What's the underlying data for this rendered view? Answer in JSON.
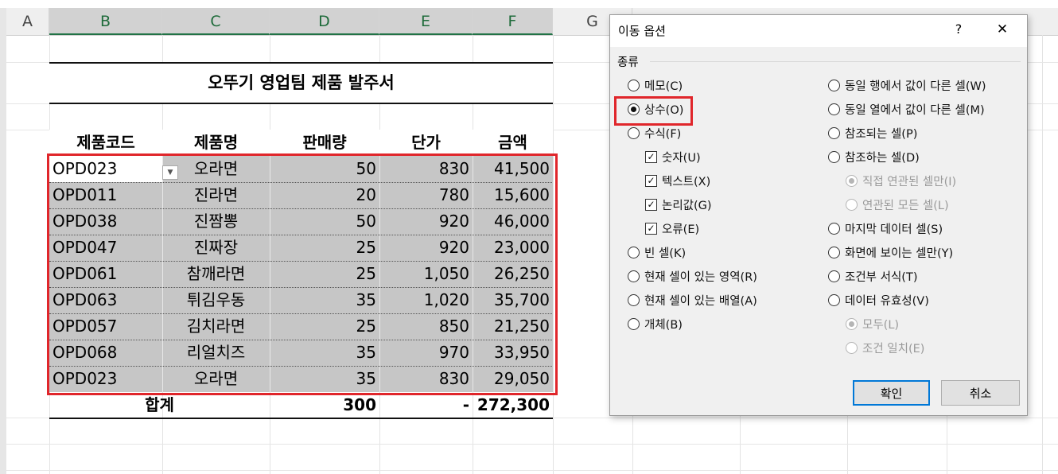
{
  "columns": [
    "A",
    "B",
    "C",
    "D",
    "E",
    "F",
    "G"
  ],
  "sheet": {
    "title": "오뚜기 영업팀 제품 발주서",
    "headers": [
      "제품코드",
      "제품명",
      "판매량",
      "단가",
      "금액"
    ],
    "rows": [
      [
        "OPD023",
        "오라면",
        "50",
        "830",
        "41,500"
      ],
      [
        "OPD011",
        "진라면",
        "20",
        "780",
        "15,600"
      ],
      [
        "OPD038",
        "진짬뽕",
        "50",
        "920",
        "46,000"
      ],
      [
        "OPD047",
        "진짜장",
        "25",
        "920",
        "23,000"
      ],
      [
        "OPD061",
        "참깨라면",
        "25",
        "1,050",
        "26,250"
      ],
      [
        "OPD063",
        "튀김우동",
        "35",
        "1,020",
        "35,700"
      ],
      [
        "OPD057",
        "김치라면",
        "25",
        "850",
        "21,250"
      ],
      [
        "OPD068",
        "리얼치즈",
        "35",
        "970",
        "33,950"
      ],
      [
        "OPD023",
        "오라면",
        "35",
        "830",
        "29,050"
      ]
    ],
    "total": {
      "label": "합계",
      "qty": "300",
      "price": "-",
      "amount": "272,300"
    }
  },
  "dialog": {
    "title": "이동 옵션",
    "help": "?",
    "close": "✕",
    "group_label": "종류",
    "left_options": [
      {
        "label": "메모(C)",
        "type": "radio",
        "checked": false,
        "enabled": true,
        "indent": 0
      },
      {
        "label": "상수(O)",
        "type": "radio",
        "checked": true,
        "enabled": true,
        "indent": 0
      },
      {
        "label": "수식(F)",
        "type": "radio",
        "checked": false,
        "enabled": true,
        "indent": 0
      },
      {
        "label": "숫자(U)",
        "type": "check",
        "checked": true,
        "enabled": true,
        "indent": 1
      },
      {
        "label": "텍스트(X)",
        "type": "check",
        "checked": true,
        "enabled": true,
        "indent": 1
      },
      {
        "label": "논리값(G)",
        "type": "check",
        "checked": true,
        "enabled": true,
        "indent": 1
      },
      {
        "label": "오류(E)",
        "type": "check",
        "checked": true,
        "enabled": true,
        "indent": 1
      },
      {
        "label": "빈 셀(K)",
        "type": "radio",
        "checked": false,
        "enabled": true,
        "indent": 0
      },
      {
        "label": "현재 셀이 있는 영역(R)",
        "type": "radio",
        "checked": false,
        "enabled": true,
        "indent": 0
      },
      {
        "label": "현재 셀이 있는 배열(A)",
        "type": "radio",
        "checked": false,
        "enabled": true,
        "indent": 0
      },
      {
        "label": "개체(B)",
        "type": "radio",
        "checked": false,
        "enabled": true,
        "indent": 0
      }
    ],
    "right_options": [
      {
        "label": "동일 행에서 값이 다른 셀(W)",
        "type": "radio",
        "checked": false,
        "enabled": true,
        "indent": 0
      },
      {
        "label": "동일 열에서 값이 다른 셀(M)",
        "type": "radio",
        "checked": false,
        "enabled": true,
        "indent": 0
      },
      {
        "label": "참조되는 셀(P)",
        "type": "radio",
        "checked": false,
        "enabled": true,
        "indent": 0
      },
      {
        "label": "참조하는 셀(D)",
        "type": "radio",
        "checked": false,
        "enabled": true,
        "indent": 0
      },
      {
        "label": "직접 연관된 셀만(I)",
        "type": "radio",
        "checked": true,
        "enabled": false,
        "indent": 1
      },
      {
        "label": "연관된 모든 셀(L)",
        "type": "radio",
        "checked": false,
        "enabled": false,
        "indent": 1
      },
      {
        "label": "마지막 데이터 셀(S)",
        "type": "radio",
        "checked": false,
        "enabled": true,
        "indent": 0
      },
      {
        "label": "화면에 보이는 셀만(Y)",
        "type": "radio",
        "checked": false,
        "enabled": true,
        "indent": 0
      },
      {
        "label": "조건부 서식(T)",
        "type": "radio",
        "checked": false,
        "enabled": true,
        "indent": 0
      },
      {
        "label": "데이터 유효성(V)",
        "type": "radio",
        "checked": false,
        "enabled": true,
        "indent": 0
      },
      {
        "label": "모두(L)",
        "type": "radio",
        "checked": true,
        "enabled": false,
        "indent": 1
      },
      {
        "label": "조건 일치(E)",
        "type": "radio",
        "checked": false,
        "enabled": false,
        "indent": 1
      }
    ],
    "ok_label": "확인",
    "cancel_label": "취소"
  },
  "colors": {
    "highlight": "#e0262b",
    "selection": "#c6c6c6",
    "accent": "#217346"
  }
}
